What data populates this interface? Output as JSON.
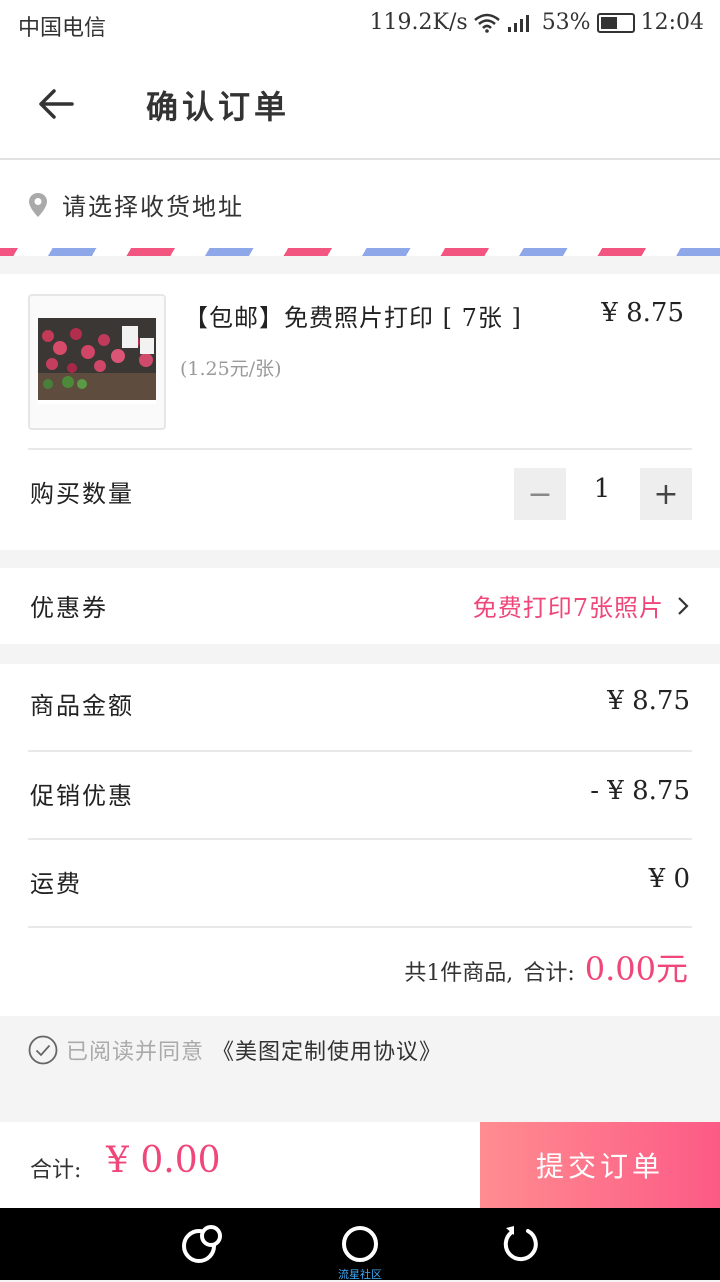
{
  "status_bar": {
    "carrier": "中国电信",
    "net_speed": "119.2K/s",
    "battery": "53%",
    "time": "12:04"
  },
  "header": {
    "title": "确认订单"
  },
  "address": {
    "placeholder": "请选择收货地址"
  },
  "product": {
    "title": "【包邮】免费照片打印 [ 7张 ]",
    "price": "¥ 8.75",
    "unit_price": "(1.25元/张)",
    "quantity_label": "购买数量",
    "quantity": "1",
    "minus": "−",
    "plus": "+"
  },
  "coupon": {
    "label": "优惠券",
    "value": "免费打印7张照片"
  },
  "amounts": {
    "goods_label": "商品金额",
    "goods_value": "¥ 8.75",
    "promo_label": "促销优惠",
    "promo_value": "- ¥ 8.75",
    "shipping_label": "运费",
    "shipping_value": "¥ 0",
    "count_text": "共1件商品,",
    "total_label": "合计:",
    "total_value": "0.00元"
  },
  "agreement": {
    "prefix": "已阅读并同意",
    "link": "《美图定制使用协议》"
  },
  "bottom_bar": {
    "sum_label": "合计:",
    "sum_value": "¥ 0.00",
    "submit_label": "提交订单"
  },
  "nav_bar": {
    "caption": "流星社区"
  },
  "colors": {
    "accent": "#f0477a",
    "submit_start": "#ff8d90",
    "submit_end": "#fc5a86"
  }
}
